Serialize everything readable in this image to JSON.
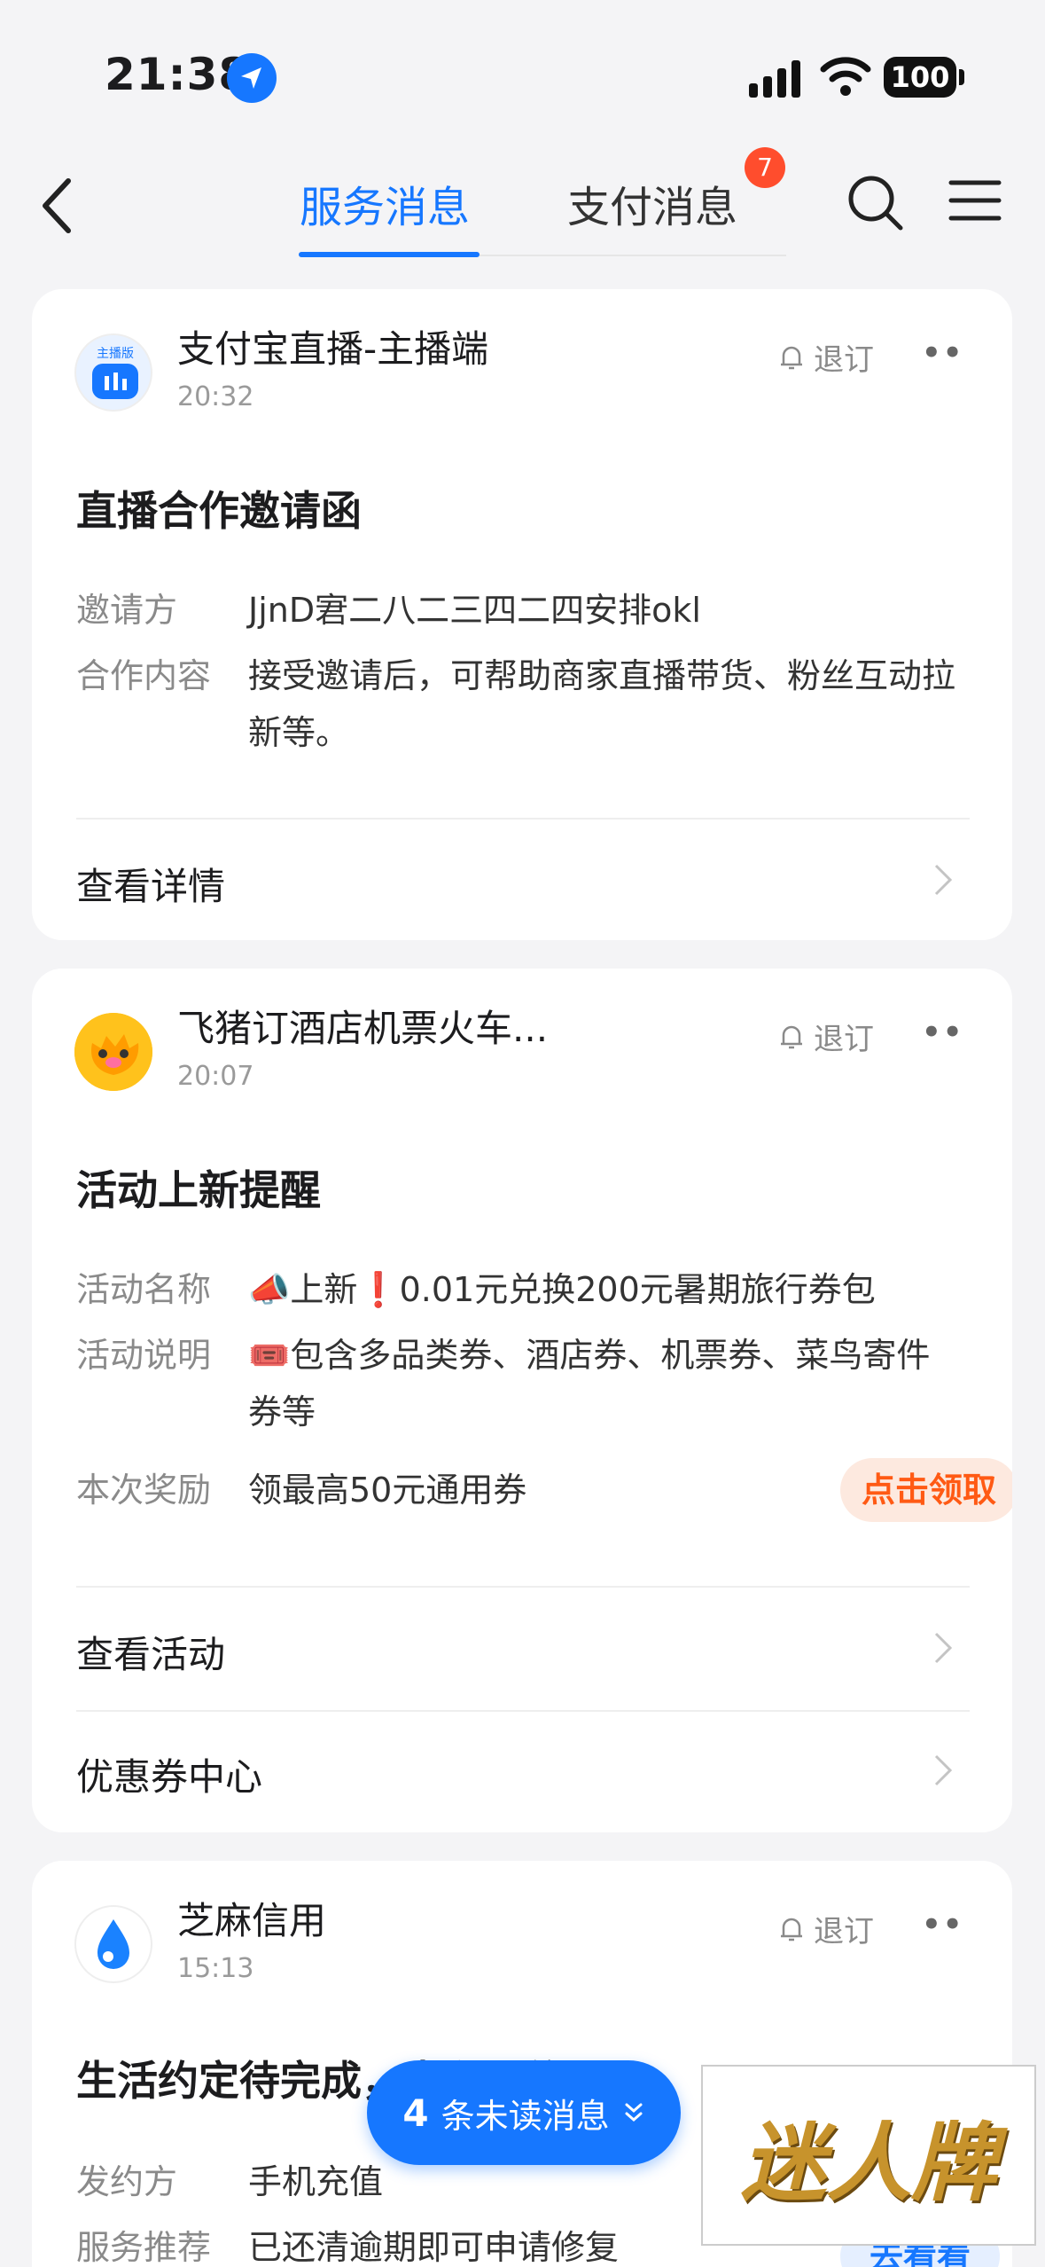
{
  "status_bar": {
    "time": "21:38",
    "battery": "100"
  },
  "nav": {
    "tabs": [
      {
        "label": "服务消息",
        "active": true
      },
      {
        "label": "支付消息",
        "active": false,
        "badge": "7"
      }
    ]
  },
  "cards": [
    {
      "sender": "支付宝直播-主播端",
      "avatar_text": "主播版",
      "time": "20:32",
      "unsubscribe": "退订",
      "title": "直播合作邀请函",
      "fields": [
        {
          "key": "邀请方",
          "value": "JjnD宭二八二三四二四安排okl"
        },
        {
          "key": "合作内容",
          "value": "接受邀请后，可帮助商家直播带货、粉丝互动拉新等。"
        }
      ],
      "links": [
        "查看详情"
      ]
    },
    {
      "sender": "飞猪订酒店机票火车...",
      "time": "20:07",
      "unsubscribe": "退订",
      "title": "活动上新提醒",
      "fields": [
        {
          "key": "活动名称",
          "value": "📣上新❗0.01元兑换200元暑期旅行券包"
        },
        {
          "key": "活动说明",
          "value": "🎟️包含多品类券、酒店券、机票券、菜鸟寄件券等"
        },
        {
          "key": "本次奖励",
          "value": "领最高50元通用券",
          "action": "点击领取"
        }
      ],
      "links": [
        "查看活动",
        "优惠券中心"
      ]
    },
    {
      "sender": "芝麻信用",
      "time": "15:13",
      "unsubscribe": "退订",
      "title": "生活约定待完成，去积累信用",
      "fields": [
        {
          "key": "发约方",
          "value": "手机充值"
        },
        {
          "key": "服务推荐",
          "value": "已还清逾期即可申请修复",
          "action": "去看看"
        }
      ]
    }
  ],
  "floating": {
    "count": "4",
    "label": "条未读消息"
  },
  "ad": {
    "text": "迷人牌"
  },
  "colors": {
    "accent": "#1677ff",
    "orange": "#ff6a10",
    "badge": "#ff4d2d"
  }
}
